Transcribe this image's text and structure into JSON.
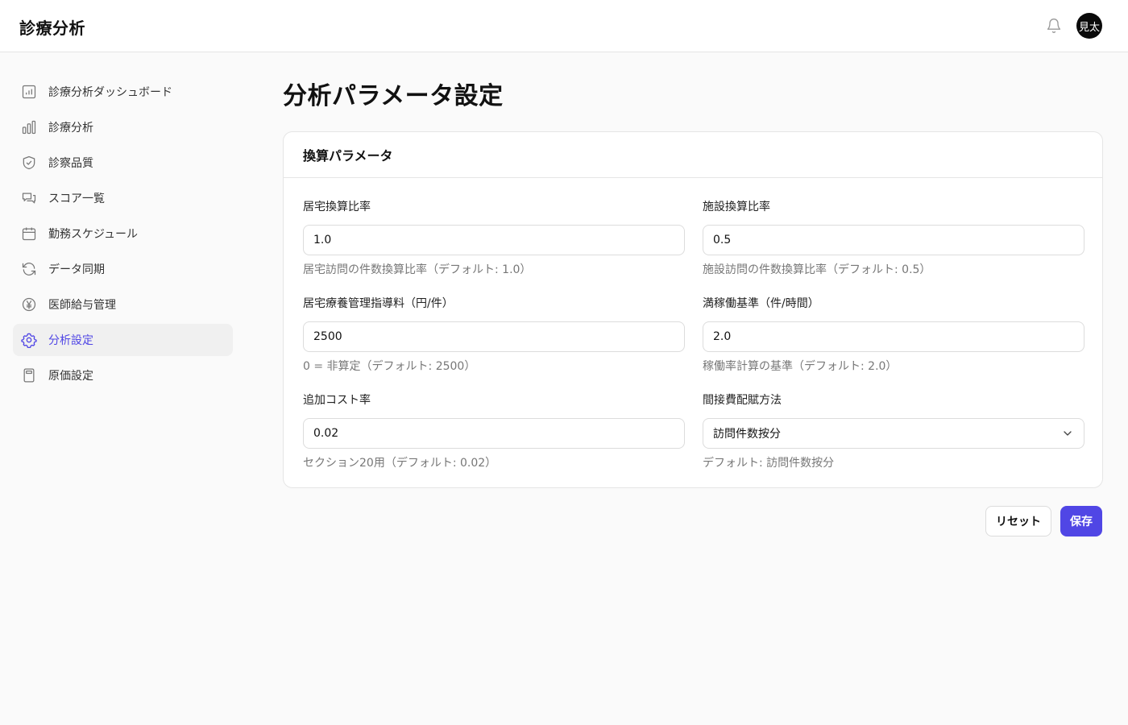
{
  "header": {
    "app_title": "診療分析",
    "avatar_text": "見太"
  },
  "sidebar": {
    "items": [
      {
        "label": "診療分析ダッシュボード",
        "icon": "dashboard-chart-icon"
      },
      {
        "label": "診療分析",
        "icon": "bar-chart-icon"
      },
      {
        "label": "診察品質",
        "icon": "shield-check-icon"
      },
      {
        "label": "スコア一覧",
        "icon": "chat-bubbles-icon"
      },
      {
        "label": "勤務スケジュール",
        "icon": "calendar-icon"
      },
      {
        "label": "データ同期",
        "icon": "refresh-icon"
      },
      {
        "label": "医師給与管理",
        "icon": "yen-circle-icon"
      },
      {
        "label": "分析設定",
        "icon": "gear-icon",
        "active": true
      },
      {
        "label": "原価設定",
        "icon": "calculator-icon"
      }
    ]
  },
  "main": {
    "page_title": "分析パラメータ設定",
    "card_title": "換算パラメータ",
    "fields": {
      "home_ratio": {
        "label": "居宅換算比率",
        "value": "1.0",
        "help": "居宅訪問の件数換算比率（デフォルト: 1.0）"
      },
      "facility_ratio": {
        "label": "施設換算比率",
        "value": "0.5",
        "help": "施設訪問の件数換算比率（デフォルト: 0.5）"
      },
      "home_fee": {
        "label": "居宅療養管理指導料（円/件）",
        "value": "2500",
        "help": "0 = 非算定（デフォルト: 2500）"
      },
      "full_util": {
        "label": "満稼働基準（件/時間）",
        "value": "2.0",
        "help": "稼働率計算の基準（デフォルト: 2.0）"
      },
      "extra_cost": {
        "label": "追加コスト率",
        "value": "0.02",
        "help": "セクション20用（デフォルト: 0.02）"
      },
      "indirect_method": {
        "label": "間接費配賦方法",
        "value": "訪問件数按分",
        "help": "デフォルト: 訪問件数按分"
      }
    },
    "buttons": {
      "reset": "リセット",
      "save": "保存"
    }
  },
  "colors": {
    "accent": "#5046e5",
    "active_bg": "#f0f0f0",
    "avatar_bg": "#0a0a0a"
  }
}
